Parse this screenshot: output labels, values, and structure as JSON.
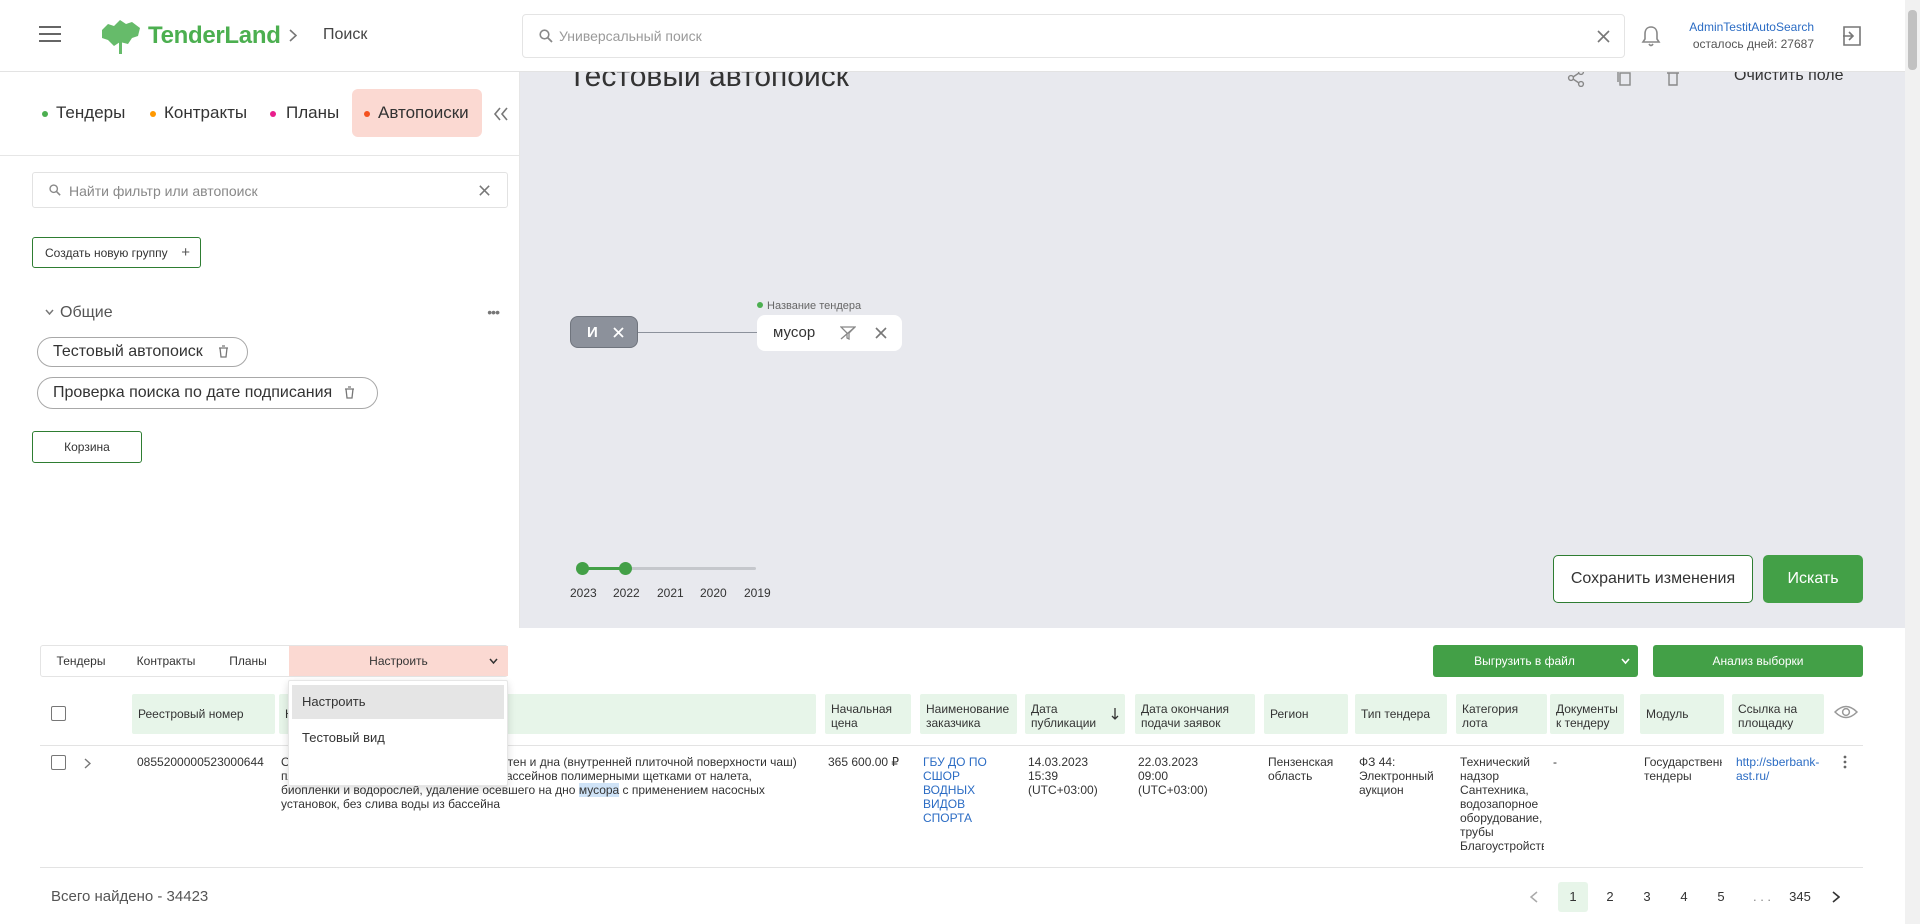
{
  "header": {
    "logo_text": "TenderLand",
    "breadcrumb": "Поиск",
    "search_placeholder": "Универсальный поиск",
    "user_name": "AdminTestitAutoSearch",
    "days_left": "осталось дней: 27687"
  },
  "left_tabs": [
    {
      "label": "Тендеры",
      "dot_color": "#4caf50"
    },
    {
      "label": "Контракты",
      "dot_color": "#ff9800"
    },
    {
      "label": "Планы",
      "dot_color": "#e91e8c"
    },
    {
      "label": "Автопоиски",
      "dot_color": "#f4511e"
    }
  ],
  "filter_search": {
    "placeholder": "Найти фильтр или автопоиск"
  },
  "create_group_label": "Создать новую группу",
  "group": {
    "title": "Общие",
    "items": [
      "Тестовый автопоиск",
      "Проверка поиска по дате подписания"
    ]
  },
  "trash_label": "Корзина",
  "builder": {
    "title": "Тестовый автопоиск",
    "clear_label": "Очистить поле",
    "and_node": "И",
    "term_field_label": "Название тендера",
    "term_value": "мусор",
    "years": [
      "2023",
      "2022",
      "2021",
      "2020",
      "2019"
    ],
    "save_label": "Сохранить изменения",
    "search_label": "Искать"
  },
  "results": {
    "tabs": [
      "Тендеры",
      "Контракты",
      "Планы"
    ],
    "configure_label": "Настроить",
    "dropdown_options": [
      "Настроить",
      "Тестовый вид"
    ],
    "export_label": "Выгрузить в файл",
    "analysis_label": "Анализ выборки",
    "columns": {
      "reg_num": "Реестровый номер",
      "name_prefix": "Н",
      "price": "Начальная цена",
      "customer": "Наименование заказчика",
      "pub_date": "Дата публикации",
      "end_date": "Дата окончания подачи заявок",
      "region": "Регион",
      "tender_type": "Тип тендера",
      "category": "Категория лота",
      "docs": "Документы к тендеру",
      "module": "Модуль",
      "link": "Ссылка на площадку"
    },
    "row": {
      "reg_num": "0855200000523000644",
      "name_before": "Оказание услуг по водолазной очистке стен и дна (внутренней плиточной поверхности чаш) плавательного, прыжкового и детского бассейнов полимерными щетками от налета, биопленки и водорослей, удаление осевшего на дно ",
      "name_highlight": "мусора",
      "name_after": " с применением насосных установок, без слива воды из бассейна",
      "price": "365 600.00 ₽",
      "customer": "ГБУ ДО ПО СШОР ВОДНЫХ ВИДОВ СПОРТА",
      "pub_date": "14.03.2023 15:39 (UTC+03:00)",
      "end_date": "22.03.2023 09:00 (UTC+03:00)",
      "region": "Пензенская область",
      "tender_type": "ФЗ 44: Электронный аукцион",
      "category": "Технический надзор Сантехника, водозапорное оборудование, трубы Благоустройство территории и",
      "docs": "-",
      "module": "Государственные тендеры",
      "link": "http://sberbank-ast.ru/"
    },
    "total": "Всего найдено - 34423",
    "pages": [
      "1",
      "2",
      "3",
      "4",
      "5",
      ". . .",
      "345"
    ]
  },
  "colors": {
    "brand_green": "#43a047",
    "active_tab_bg": "#fbd9d2",
    "header_green_bg": "#e7f5e9",
    "builder_bg": "#e8e9ee"
  }
}
